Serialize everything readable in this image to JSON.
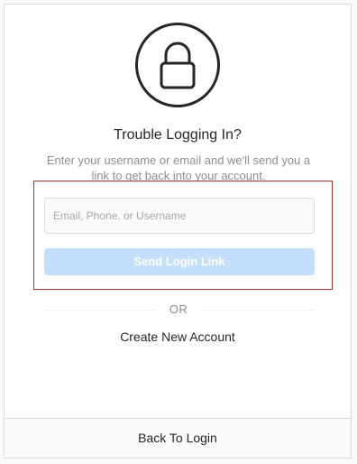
{
  "title": "Trouble Logging In?",
  "description": "Enter your username or email and we'll send you a link to get back into your account.",
  "form": {
    "input_value": "",
    "input_placeholder": "Email, Phone, or Username",
    "send_label": "Send Login Link"
  },
  "divider_label": "OR",
  "create_account_label": "Create New Account",
  "back_label": "Back To Login",
  "icon": "lock-icon",
  "colors": {
    "button_disabled": "#c4dffc",
    "highlight_border": "#a83232",
    "text_primary": "#262626",
    "text_secondary": "#8e8e8e"
  }
}
